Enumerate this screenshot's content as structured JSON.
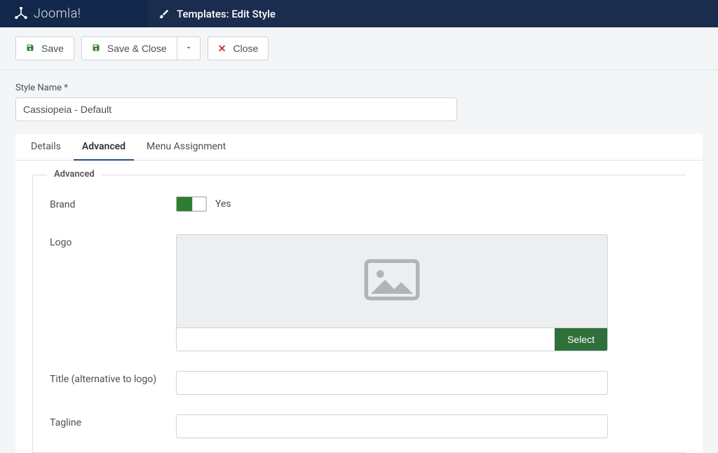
{
  "brand": "Joomla!",
  "page_title": "Templates: Edit Style",
  "toolbar": {
    "save": "Save",
    "save_close": "Save & Close",
    "close": "Close"
  },
  "style_name_label": "Style Name *",
  "style_name_value": "Cassiopeia - Default",
  "tabs": {
    "details": "Details",
    "advanced": "Advanced",
    "menu_assignment": "Menu Assignment"
  },
  "fieldset_legend": "Advanced",
  "fields": {
    "brand_label": "Brand",
    "brand_value": "Yes",
    "logo_label": "Logo",
    "logo_select": "Select",
    "title_label": "Title (alternative to logo)",
    "title_value": "",
    "tagline_label": "Tagline",
    "tagline_value": ""
  }
}
